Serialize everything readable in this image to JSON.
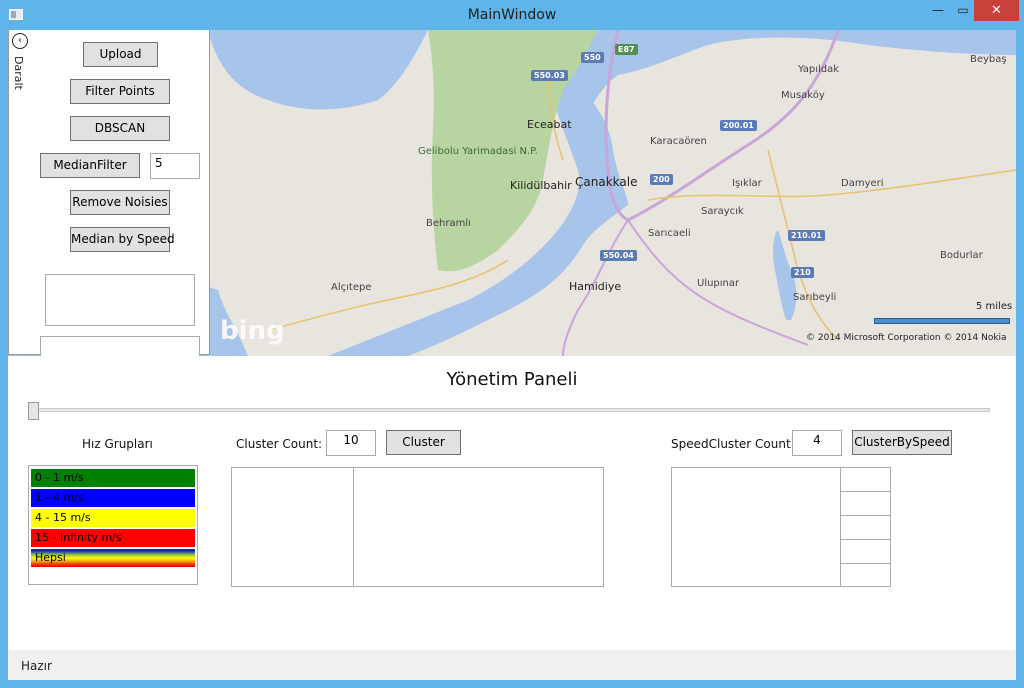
{
  "window": {
    "title": "MainWindow",
    "minimize_icon": "minimize-icon",
    "maximize_icon": "maximize-icon",
    "close_icon": "close-icon"
  },
  "map": {
    "labels": {
      "yapildak": "Yapıldak",
      "beybas": "Beybaş",
      "musakoy": "Musaköy",
      "eceabat": "Eceabat",
      "karacaoren": "Karacaören",
      "gelibolu": "Gelibolu Yarimadasi N.P.",
      "kilidulbahir": "Kilidülbahir",
      "canakkale": "Çanakkale",
      "isiklar": "Işıklar",
      "damyeri": "Damyeri",
      "saraycik": "Saraycık",
      "behramli": "Behramlı",
      "saricaeli": "Sarıcaeli",
      "bodurlar": "Bodurlar",
      "alcitepe": "Alçıtepe",
      "hamidiye": "Hamidiye",
      "ulupinar": "Ulupınar",
      "saribeyli": "Sarıbeyli"
    },
    "shields": {
      "e87": "E87",
      "r550": "550",
      "r550_03": "550.03",
      "r200_01a": "200.01",
      "r200": "200",
      "r210_01": "210.01",
      "r210": "210",
      "r550_04": "550.04"
    },
    "logo": "bing",
    "scale_label": "5 miles",
    "copyright": "© 2014 Microsoft Corporation   © 2014 Nokia"
  },
  "side_panel": {
    "collapse_label": "Daralt",
    "upload": "Upload",
    "filter_points": "Filter Points",
    "dbscan": "DBSCAN",
    "median_filter": "MedianFilter",
    "median_value": "5",
    "remove_noisies": "Remove Noisies",
    "median_by_speed": "Median by Speed"
  },
  "panel": {
    "title": "Yönetim Paneli",
    "slider_value": 0,
    "speed_groups_label": "Hız Grupları",
    "speed_groups": [
      {
        "label": "0 - 1 m/s",
        "color": "#008000"
      },
      {
        "label": "1 - 4 m/s",
        "color": "#0000ff"
      },
      {
        "label": "4 - 15 m/s",
        "color": "#ffff00"
      },
      {
        "label": "15 - Infinity m/s",
        "color": "#ff0000"
      },
      {
        "label": "Hepsi",
        "color": "gradient"
      }
    ],
    "cluster_count_label": "Cluster Count:",
    "cluster_count": "10",
    "cluster_button": "Cluster",
    "speedcluster_count_label": "SpeedCluster Count:",
    "speedcluster_count": "4",
    "clusterbyspeed_button": "ClusterBySpeed"
  },
  "status": {
    "text": "Hazır"
  }
}
